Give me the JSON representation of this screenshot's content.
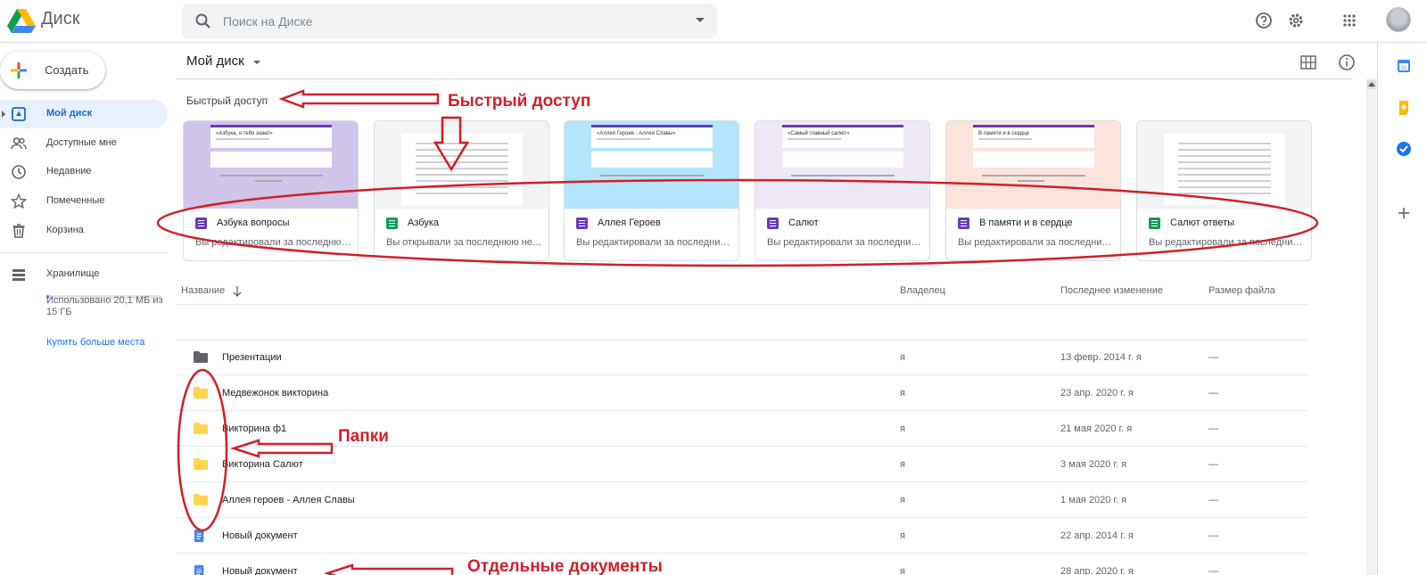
{
  "header": {
    "app_name": "Диск",
    "search_placeholder": "Поиск на Диске"
  },
  "sidebar": {
    "create_label": "Создать",
    "items": [
      {
        "label": "Мой диск",
        "icon": "my-drive-icon",
        "active": true
      },
      {
        "label": "Доступные мне",
        "icon": "shared-icon"
      },
      {
        "label": "Недавние",
        "icon": "clock-icon"
      },
      {
        "label": "Помеченные",
        "icon": "star-icon"
      },
      {
        "label": "Корзина",
        "icon": "trash-icon"
      }
    ],
    "storage_label": "Хранилище",
    "storage_used": "Использовано 20,1 МБ из 15 ГБ",
    "storage_fraction": 0.0013,
    "buy_more": "Купить больше места"
  },
  "main": {
    "breadcrumb": "Мой диск",
    "quick_access_title": "Быстрый доступ",
    "cards": [
      {
        "name": "Азбука вопросы",
        "sub": "Вы редактировали за последнюю неделю",
        "type": "form",
        "thumb_bg": "#d1c4e9",
        "thumb_title": "«Азбука, я тебя знаю!»"
      },
      {
        "name": "Азбука",
        "sub": "Вы открывали за последнюю неделю",
        "type": "sheet",
        "thumb_bg": "#f1f3f4",
        "thumb_title": ""
      },
      {
        "name": "Аллея Героев",
        "sub": "Вы редактировали за последний месяц",
        "type": "form",
        "thumb_bg": "#b3e5fc",
        "thumb_title": "«Аллея Героев - Аллея Славы»"
      },
      {
        "name": "Салют",
        "sub": "Вы редактировали за последний месяц",
        "type": "form",
        "thumb_bg": "#ede7f6",
        "thumb_title": "«Самый главный салют»"
      },
      {
        "name": "В памяти и в сердце",
        "sub": "Вы редактировали за последний месяц",
        "type": "form",
        "thumb_bg": "#fce4dc",
        "thumb_title": "В памяти и в сердце"
      },
      {
        "name": "Салют ответы",
        "sub": "Вы редактировали за последний месяц",
        "type": "sheet",
        "thumb_bg": "#f1f3f4",
        "thumb_title": ""
      }
    ],
    "columns": {
      "name": "Название",
      "owner": "Владелец",
      "modified": "Последнее изменение",
      "size": "Размер файла"
    },
    "rows": [
      {
        "name": "Презентации",
        "type": "folder-dark",
        "owner": "я",
        "modified": "13 февр. 2014 г. я",
        "size": "—"
      },
      {
        "name": "Медвежонок викторина",
        "type": "folder",
        "owner": "я",
        "modified": "23 апр. 2020 г. я",
        "size": "—"
      },
      {
        "name": "Викторина ф1",
        "type": "folder",
        "owner": "я",
        "modified": "21 мая 2020 г. я",
        "size": "—"
      },
      {
        "name": "Викторина Салют",
        "type": "folder",
        "owner": "я",
        "modified": "3 мая 2020 г. я",
        "size": "—"
      },
      {
        "name": "Аллея героев - Аллея Славы",
        "type": "folder",
        "owner": "я",
        "modified": "1 мая 2020 г. я",
        "size": "—"
      },
      {
        "name": "Новый документ",
        "type": "doc",
        "owner": "я",
        "modified": "22 апр. 2014 г. я",
        "size": "—"
      },
      {
        "name": "Новый документ",
        "type": "doc",
        "owner": "я",
        "modified": "28 апр. 2020 г. я",
        "size": "—"
      }
    ]
  },
  "annotations": {
    "quick_access": "Быстрый доступ",
    "folders": "Папки",
    "documents": "Отдельные документы",
    "color": "#d11f28"
  },
  "colors": {
    "accent": "#1a73e8",
    "form": "#673ab7",
    "sheet": "#0f9d58",
    "doc": "#4285f4",
    "folder": "#ffd54f",
    "folder_dark": "#5f6368"
  }
}
